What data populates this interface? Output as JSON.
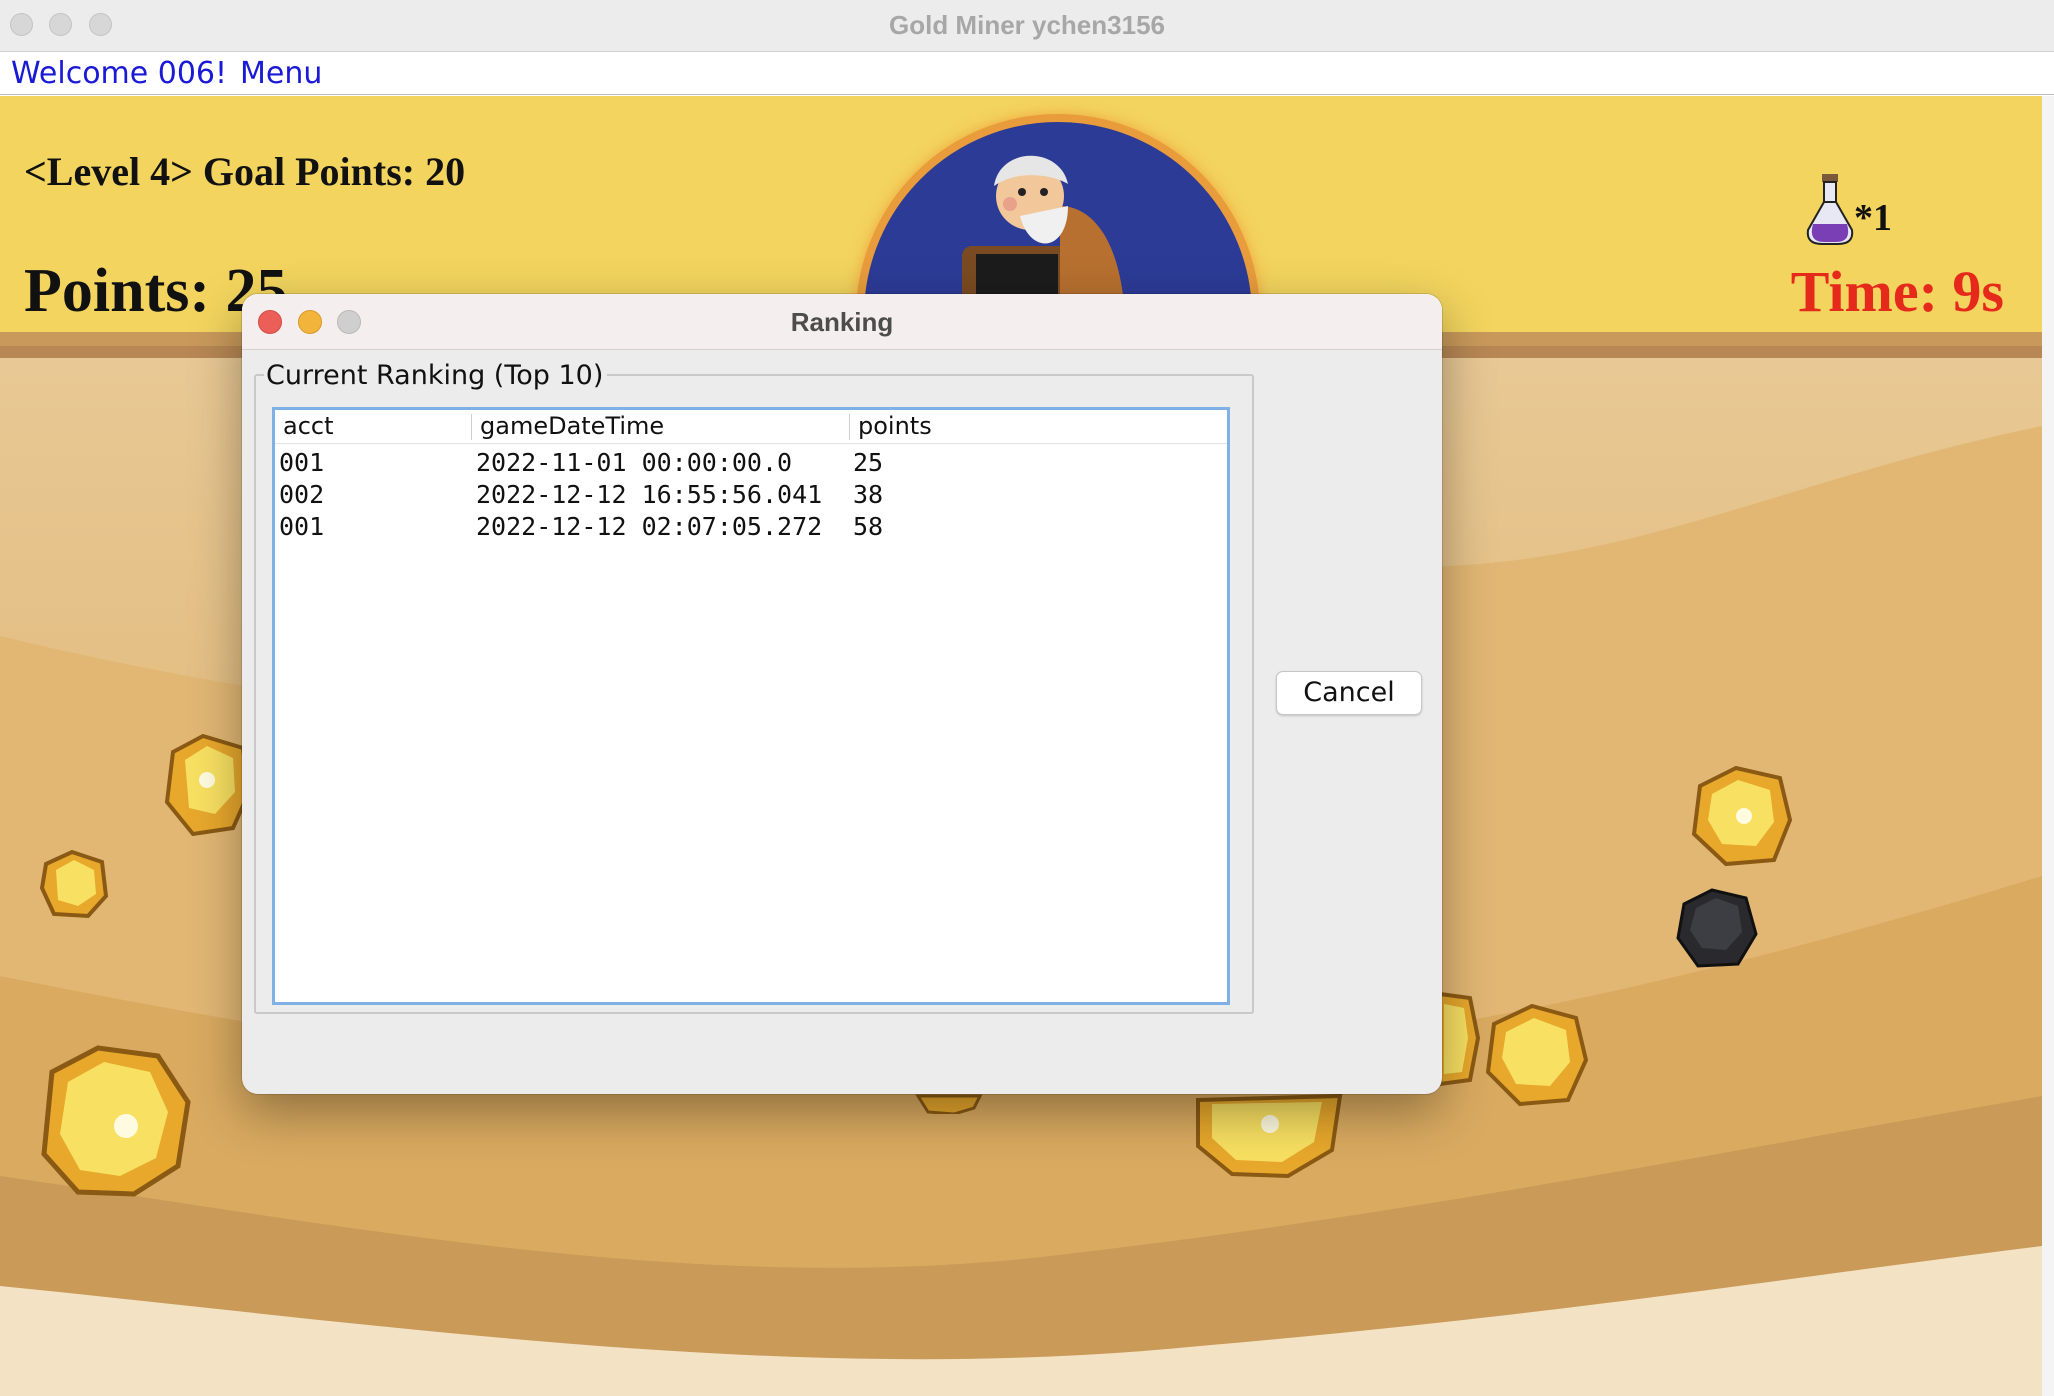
{
  "window": {
    "title": "Gold Miner ychen3156"
  },
  "menubar": {
    "welcome": "Welcome 006!",
    "menu": "Menu"
  },
  "hud": {
    "level_goal": "<Level 4> Goal Points: 20",
    "points": "Points: 25",
    "time": "Time: 9s",
    "potion_count": "*1"
  },
  "dialog": {
    "title": "Ranking",
    "group_title": "Current Ranking (Top 10)",
    "columns": [
      "acct",
      "gameDateTime",
      "points"
    ],
    "rows": [
      [
        "001",
        "2022-11-01 00:00:00.0",
        "25"
      ],
      [
        "002",
        "2022-12-12 16:55:56.041",
        "38"
      ],
      [
        "001",
        "2022-12-12 02:07:05.272",
        "58"
      ]
    ],
    "cancel_label": "Cancel"
  },
  "colors": {
    "sky": "#f2d45e",
    "sand": "#e0b56a",
    "time_red": "#e52a1c",
    "link_blue": "#1a1ad6",
    "table_focus": "#7fb0e6"
  }
}
